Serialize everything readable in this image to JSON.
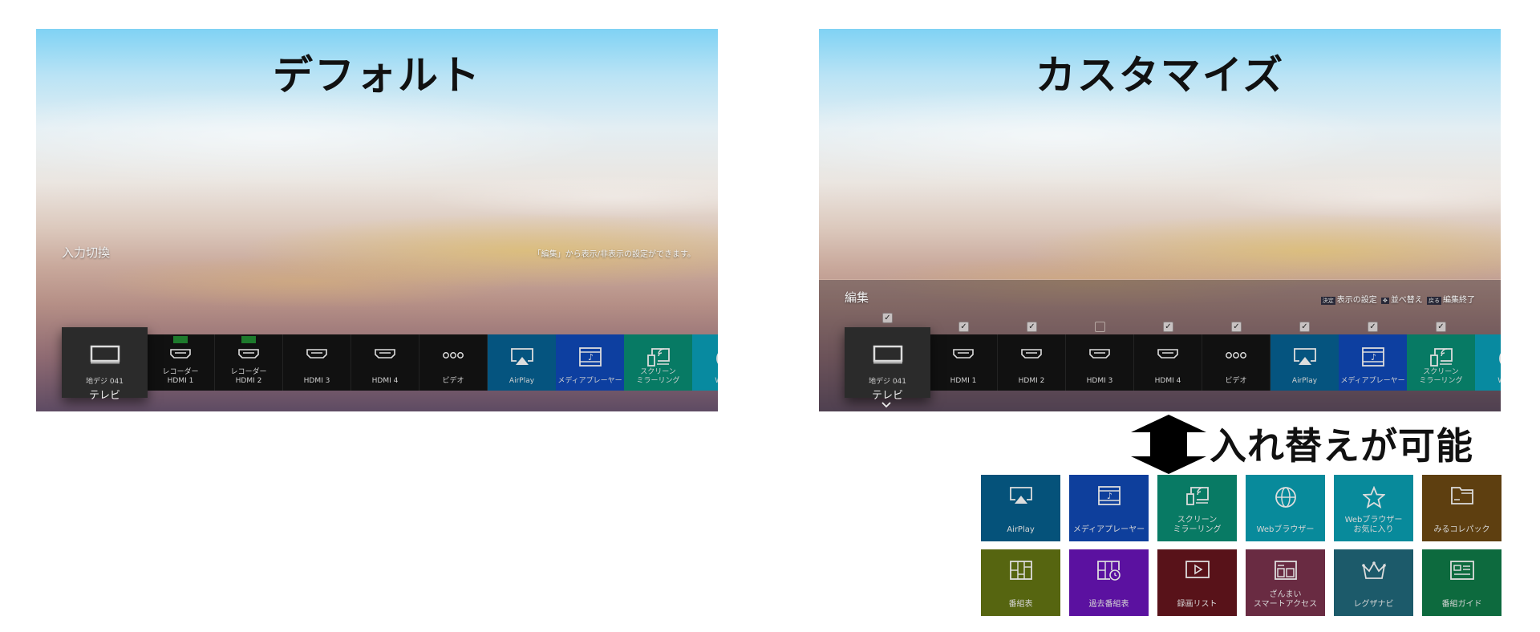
{
  "left": {
    "title": "デフォルト",
    "menu_label": "入力切換",
    "hint": "「編集」から表示/非表示の設定ができます。",
    "focused": {
      "channel": "地デジ 041",
      "name": "テレビ",
      "icon": "tv-icon"
    },
    "items": [
      {
        "line1": "レコーダー",
        "line2": "HDMI 1",
        "icon": "hdmi-icon",
        "regza_link": true,
        "bg": "#111111"
      },
      {
        "line1": "レコーダー",
        "line2": "HDMI 2",
        "icon": "hdmi-icon",
        "regza_link": true,
        "bg": "#111111"
      },
      {
        "line1": "",
        "line2": "HDMI 3",
        "icon": "hdmi-icon",
        "regza_link": false,
        "bg": "#111111"
      },
      {
        "line1": "",
        "line2": "HDMI 4",
        "icon": "hdmi-icon",
        "regza_link": false,
        "bg": "#111111"
      },
      {
        "line1": "",
        "line2": "ビデオ",
        "icon": "video-icon",
        "regza_link": false,
        "bg": "#111111"
      },
      {
        "line1": "",
        "line2": "AirPlay",
        "icon": "airplay-icon",
        "regza_link": false,
        "bg": "#05547f"
      },
      {
        "line1": "",
        "line2": "メディアプレーヤー",
        "icon": "media-player-icon",
        "regza_link": false,
        "bg": "#0d3fa0"
      },
      {
        "line1": "スクリーン",
        "line2": "ミラーリング",
        "icon": "screen-mirroring-icon",
        "regza_link": false,
        "bg": "#077a64"
      },
      {
        "line1": "",
        "line2": "Webブ",
        "icon": "globe-icon",
        "regza_link": false,
        "bg": "#088aa0"
      }
    ]
  },
  "right": {
    "title": "カスタマイズ",
    "menu_label": "編集",
    "hint": {
      "key1": "決定",
      "text1": "表示の設定",
      "text2": "並べ替え",
      "key3": "戻る",
      "text3": "編集終了"
    },
    "focused": {
      "channel": "地デジ 041",
      "name": "テレビ",
      "icon": "tv-icon",
      "checked": true
    },
    "chevron": "⌄",
    "items": [
      {
        "line1": "",
        "line2": "HDMI 1",
        "icon": "hdmi-icon",
        "checked": true,
        "bg": "#111111"
      },
      {
        "line1": "",
        "line2": "HDMI 2",
        "icon": "hdmi-icon",
        "checked": true,
        "bg": "#111111"
      },
      {
        "line1": "",
        "line2": "HDMI 3",
        "icon": "hdmi-icon",
        "checked": false,
        "bg": "#111111"
      },
      {
        "line1": "",
        "line2": "HDMI 4",
        "icon": "hdmi-icon",
        "checked": true,
        "bg": "#111111"
      },
      {
        "line1": "",
        "line2": "ビデオ",
        "icon": "video-icon",
        "checked": true,
        "bg": "#111111"
      },
      {
        "line1": "",
        "line2": "AirPlay",
        "icon": "airplay-icon",
        "checked": true,
        "bg": "#05547f"
      },
      {
        "line1": "",
        "line2": "メディアプレーヤー",
        "icon": "media-player-icon",
        "checked": true,
        "bg": "#0d3fa0"
      },
      {
        "line1": "スクリーン",
        "line2": "ミラーリング",
        "icon": "screen-mirroring-icon",
        "checked": true,
        "bg": "#077a64"
      },
      {
        "line1": "",
        "line2": "Webブ",
        "icon": "globe-icon",
        "checked": null,
        "bg": "#088aa0"
      }
    ]
  },
  "swap_label": "入れ替えが可能",
  "tiles": [
    {
      "label": "AirPlay",
      "icon": "airplay-icon",
      "bg": "#05527a"
    },
    {
      "label": "メディアプレーヤー",
      "icon": "media-player-icon",
      "bg": "#0e3f9c"
    },
    {
      "label": "スクリーン\nミラーリング",
      "icon": "screen-mirroring-icon",
      "bg": "#087a64"
    },
    {
      "label": "Webブラウザー",
      "icon": "globe-icon",
      "bg": "#088a9b"
    },
    {
      "label": "Webブラウザー\nお気に入り",
      "icon": "star-icon",
      "bg": "#088a9b"
    },
    {
      "label": "みるコレパック",
      "icon": "folder-icon",
      "bg": "#5e3f10"
    },
    {
      "label": "番組表",
      "icon": "program-guide-icon",
      "bg": "#566510"
    },
    {
      "label": "過去番組表",
      "icon": "past-program-guide-icon",
      "bg": "#5b11a0"
    },
    {
      "label": "録画リスト",
      "icon": "recording-list-icon",
      "bg": "#581219"
    },
    {
      "label": "ざんまい\nスマートアクセス",
      "icon": "smart-access-icon",
      "bg": "#692b42"
    },
    {
      "label": "レグザナビ",
      "icon": "crown-icon",
      "bg": "#1c5a6a"
    },
    {
      "label": "番組ガイド",
      "icon": "program-info-icon",
      "bg": "#0d6a3e"
    }
  ]
}
